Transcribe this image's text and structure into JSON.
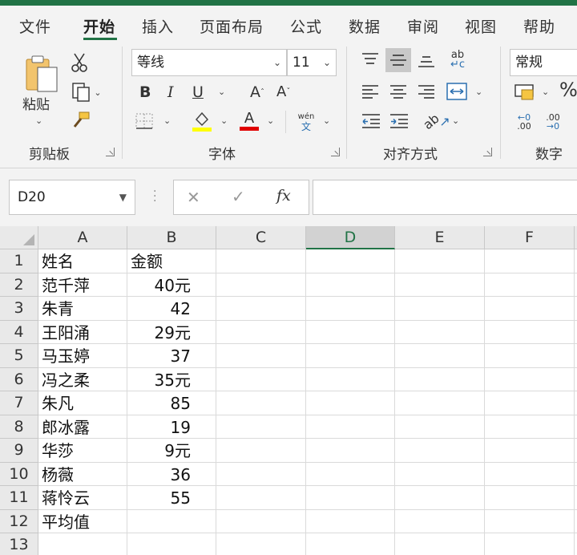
{
  "ribbon_tabs": [
    "文件",
    "开始",
    "插入",
    "页面布局",
    "公式",
    "数据",
    "审阅",
    "视图",
    "帮助"
  ],
  "active_tab": "开始",
  "clipboard": {
    "paste_label": "粘贴",
    "group_label": "剪贴板"
  },
  "font": {
    "family": "等线",
    "size": "11",
    "group_label": "字体",
    "bold": "B",
    "italic": "I",
    "underline": "U",
    "grow": "A",
    "shrink": "A",
    "phonetic_top": "wén",
    "phonetic_bottom": "文",
    "font_color_letter": "A",
    "highlight_color": "#FFFF00",
    "font_color": "#E00000"
  },
  "alignment": {
    "group_label": "对齐方式"
  },
  "number": {
    "format": "常规",
    "group_label": "数字",
    "percent": "%"
  },
  "formula_bar": {
    "name_box": "D20",
    "cancel": "✕",
    "enter": "✓",
    "fx": "fx",
    "value": ""
  },
  "columns": [
    "A",
    "B",
    "C",
    "D",
    "E",
    "F"
  ],
  "selected_column": "D",
  "rows": [
    {
      "n": "1",
      "a": "姓名",
      "b": "金额"
    },
    {
      "n": "2",
      "a": "范千萍",
      "b": "40元"
    },
    {
      "n": "3",
      "a": "朱青",
      "b": "42"
    },
    {
      "n": "4",
      "a": "王阳涌",
      "b": "29元"
    },
    {
      "n": "5",
      "a": "马玉婷",
      "b": "37"
    },
    {
      "n": "6",
      "a": "冯之柔",
      "b": "35元"
    },
    {
      "n": "7",
      "a": "朱凡",
      "b": "85"
    },
    {
      "n": "8",
      "a": "郎冰露",
      "b": "19"
    },
    {
      "n": "9",
      "a": "华莎",
      "b": "9元"
    },
    {
      "n": "10",
      "a": "杨薇",
      "b": "36"
    },
    {
      "n": "11",
      "a": "蒋怜云",
      "b": "55"
    },
    {
      "n": "12",
      "a": "平均值",
      "b": ""
    },
    {
      "n": "13",
      "a": "",
      "b": ""
    }
  ],
  "accent_color": "#217346"
}
